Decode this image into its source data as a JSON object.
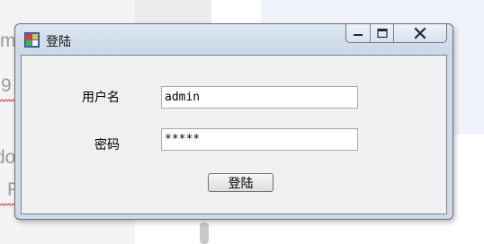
{
  "background": {
    "texts": [
      "m",
      "9",
      "do",
      "R"
    ]
  },
  "window": {
    "title": "登陆",
    "icons": {
      "app": "app-window-icon",
      "minimize": "minimize-icon",
      "maximize": "maximize-icon",
      "close": "close-icon"
    }
  },
  "form": {
    "username_label": "用户名",
    "username_value": "admin",
    "password_label": "密码",
    "password_masked": "*****",
    "login_button": "登陆"
  },
  "colors": {
    "frame": "#cfdbe9",
    "client": "#f0f0f0",
    "error_squiggle": "#e23a3a"
  }
}
